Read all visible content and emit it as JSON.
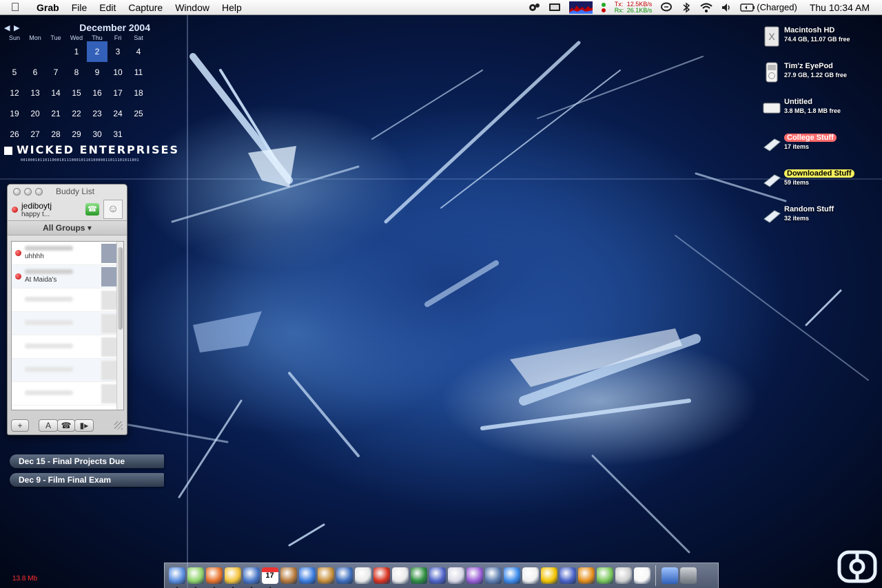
{
  "menubar": {
    "app": "Grab",
    "items": [
      "File",
      "Edit",
      "Capture",
      "Window",
      "Help"
    ],
    "net_tx_label": "Tx:",
    "net_tx": "12.5KB/s",
    "net_rx_label": "Rx:",
    "net_rx": "26.1KB/s",
    "battery": "(Charged)",
    "clock": "Thu 10:34 AM"
  },
  "calendar": {
    "month": "December 2004",
    "weekdays": [
      "Sun",
      "Mon",
      "Tue",
      "Wed",
      "Thu",
      "Fri",
      "Sat"
    ],
    "weeks": [
      [
        "",
        "",
        "",
        "1",
        "2",
        "3",
        "4"
      ],
      [
        "5",
        "6",
        "7",
        "8",
        "9",
        "10",
        "11"
      ],
      [
        "12",
        "13",
        "14",
        "15",
        "16",
        "17",
        "18"
      ],
      [
        "19",
        "20",
        "21",
        "22",
        "23",
        "24",
        "25"
      ],
      [
        "26",
        "27",
        "28",
        "29",
        "30",
        "31",
        ""
      ]
    ],
    "today": "2"
  },
  "branding": {
    "title": "WICKED ENTERPRISES",
    "bits": "0010001011011000101110001011010000011011101011001"
  },
  "buddy_list": {
    "title": "Buddy List",
    "me": {
      "name": "jediboytj",
      "status": "happy t..."
    },
    "groups_label": "All Groups",
    "buddies": [
      {
        "message": "uhhhh",
        "online": true
      },
      {
        "message": "At Maida's",
        "online": true
      },
      {
        "message": "",
        "online": false
      },
      {
        "message": "",
        "online": false
      },
      {
        "message": "",
        "online": false
      },
      {
        "message": "",
        "online": false
      },
      {
        "message": "",
        "online": false
      }
    ],
    "add_label": "+",
    "text_label": "A"
  },
  "reminders": [
    "Dec 15 - Final Projects Due",
    "Dec 9 - Film Final Exam"
  ],
  "desktop_icons": [
    {
      "name": "Macintosh HD",
      "info": "74.4 GB, 11.07 GB free",
      "label_color": "none"
    },
    {
      "name": "Tim'z EyePod",
      "info": "27.9 GB, 1.22 GB free",
      "label_color": "none"
    },
    {
      "name": "Untitled",
      "info": "3.8 MB, 1.8 MB free",
      "label_color": "none"
    },
    {
      "name": "College Stuff",
      "info": "17 items",
      "label_color": "#ff6b6b"
    },
    {
      "name": "Downloaded Stuff",
      "info": "59 items",
      "label_color": "#f3ef5c"
    },
    {
      "name": "Random Stuff",
      "info": "32 items",
      "label_color": "none"
    }
  ],
  "memory_readout": "13.8 Mb",
  "dock": {
    "apps": [
      "finder-icon",
      "itunes-icon",
      "firefox-icon",
      "aim-icon",
      "mail-icon",
      "ical-icon",
      "iphoto-icon",
      "imovie-icon",
      "garageband-icon",
      "dictionary-icon",
      "dvd-player-icon",
      "flash-icon",
      "final-cut-icon",
      "money-icon",
      "clapper-icon",
      "ipod-icon",
      "disc-utility-icon",
      "server-icon",
      "quicktime-icon",
      "address-icon",
      "caution-icon",
      "xcode-icon",
      "transmit-icon",
      "adium-icon",
      "calculator-icon",
      "activity-monitor-icon"
    ],
    "calendar_day": "17",
    "docs": [
      "applications-icon",
      "trash-icon"
    ]
  }
}
